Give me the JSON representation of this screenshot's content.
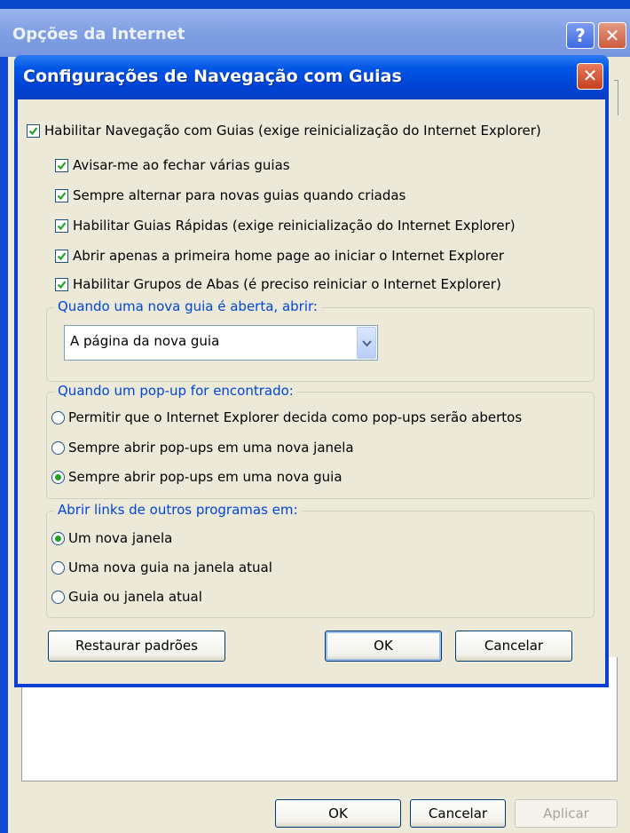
{
  "parent_window": {
    "title": "Opções da Internet",
    "help_button": "?",
    "close_button": "✕",
    "buttons": {
      "ok": "OK",
      "cancel": "Cancelar",
      "apply": "Aplicar"
    }
  },
  "dialog": {
    "title": "Configurações de Navegação com Guias",
    "close_button": "✕",
    "enable_tabs": {
      "label": "Habilitar Navegação com Guias (exige reinicialização do Internet Explorer)",
      "checked": true
    },
    "tab_options": [
      {
        "label": "Avisar-me ao fechar várias guias",
        "checked": true
      },
      {
        "label": "Sempre alternar para novas guias quando criadas",
        "checked": true
      },
      {
        "label": "Habilitar Guias Rápidas (exige reinicialização do Internet Explorer)",
        "checked": true
      },
      {
        "label": "Abrir apenas a primeira home page ao iniciar o Internet Explorer",
        "checked": true
      },
      {
        "label": "Habilitar Grupos de Abas (é preciso reiniciar o Internet Explorer)",
        "checked": true
      }
    ],
    "new_tab_group": {
      "legend": "Quando uma nova guia é aberta, abrir:",
      "selected": "A página da nova guia"
    },
    "popup_group": {
      "legend": "Quando um pop-up for encontrado:",
      "options": [
        {
          "label": "Permitir que o Internet Explorer decida como pop-ups serão abertos",
          "selected": false
        },
        {
          "label": "Sempre abrir pop-ups em uma nova janela",
          "selected": false
        },
        {
          "label": "Sempre abrir pop-ups em uma nova guia",
          "selected": true
        }
      ]
    },
    "links_group": {
      "legend": "Abrir links de outros programas em:",
      "options": [
        {
          "label": "Um nova janela",
          "selected": true
        },
        {
          "label": "Uma nova guia na janela atual",
          "selected": false
        },
        {
          "label": "Guia ou janela atual",
          "selected": false
        }
      ]
    },
    "buttons": {
      "restore": "Restaurar padrões",
      "ok": "OK",
      "cancel": "Cancelar"
    }
  },
  "colors": {
    "dialog_titlebar": "#0055e5",
    "group_legend": "#0046d5",
    "window_background": "#ece9d8",
    "check_mark": "#21a121"
  }
}
